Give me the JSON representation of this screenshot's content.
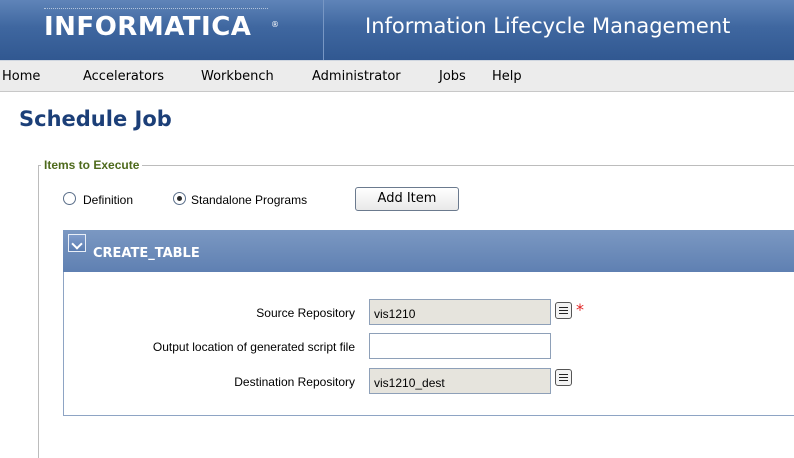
{
  "header": {
    "logo_text": "INFORMATICA",
    "logo_reg": "®",
    "app_title": "Information Lifecycle Management",
    "colors": {
      "background": "#3f67a0",
      "text": "#ffffff"
    }
  },
  "menu": {
    "items": [
      "Home",
      "Accelerators",
      "Workbench",
      "Administrator",
      "Jobs",
      "Help"
    ]
  },
  "page": {
    "title": "Schedule Job"
  },
  "items_to_execute": {
    "legend": "Items to Execute",
    "options": [
      {
        "label": "Definition",
        "checked": false
      },
      {
        "label": "Standalone Programs",
        "checked": true
      }
    ],
    "add_item_label": "Add Item"
  },
  "panel": {
    "title": "CREATE_TABLE",
    "fields": [
      {
        "label": "Source Repository",
        "value": "vis1210",
        "readonly": true,
        "lookup_icon": "list-icon",
        "required": true
      },
      {
        "label": "Output location of generated script file",
        "value": "",
        "readonly": false
      },
      {
        "label": "Destination Repository",
        "value": "vis1210_dest",
        "readonly": true,
        "lookup_icon": "list-icon",
        "required": false
      }
    ],
    "required_marker": "*",
    "colors": {
      "header": "#6b8bbb",
      "required": "#e02222"
    }
  }
}
